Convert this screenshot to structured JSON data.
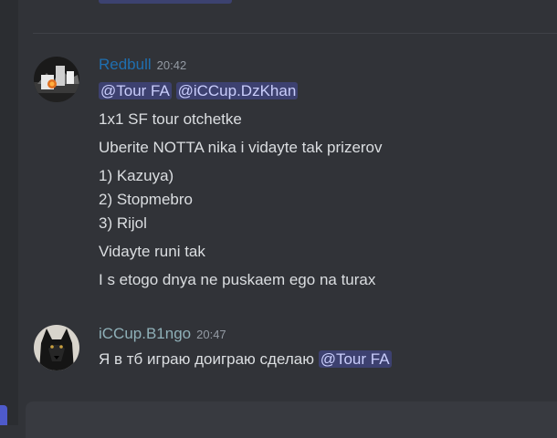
{
  "colors": {
    "background": "#313338",
    "redbull_name": "#1f6fb0",
    "bingo_name": "#8fb0b8",
    "mention_bg": "#3c4270",
    "mention_text": "#c9cdfb"
  },
  "messages": [
    {
      "author": "Redbull",
      "time": "20:42",
      "avatar_icon": "avatar-redbull-icon",
      "mentions": [
        "@Tour FA",
        "@iCCup.DzKhan"
      ],
      "lines": [
        "1x1 SF tour otchetke",
        "Uberite NOTTA nika i vidayte tak prizerov",
        "1) Kazuya)",
        "2) Stopmebro",
        "3) Rijol",
        "Vidayte runi tak",
        "I s etogo dnya ne puskaem ego na turax"
      ]
    },
    {
      "author": "iCCup.B1ngo",
      "time": "20:47",
      "avatar_icon": "avatar-wolf-icon",
      "text": "Я в тб играю доиграю сделаю",
      "mention": "@Tour FA"
    }
  ]
}
